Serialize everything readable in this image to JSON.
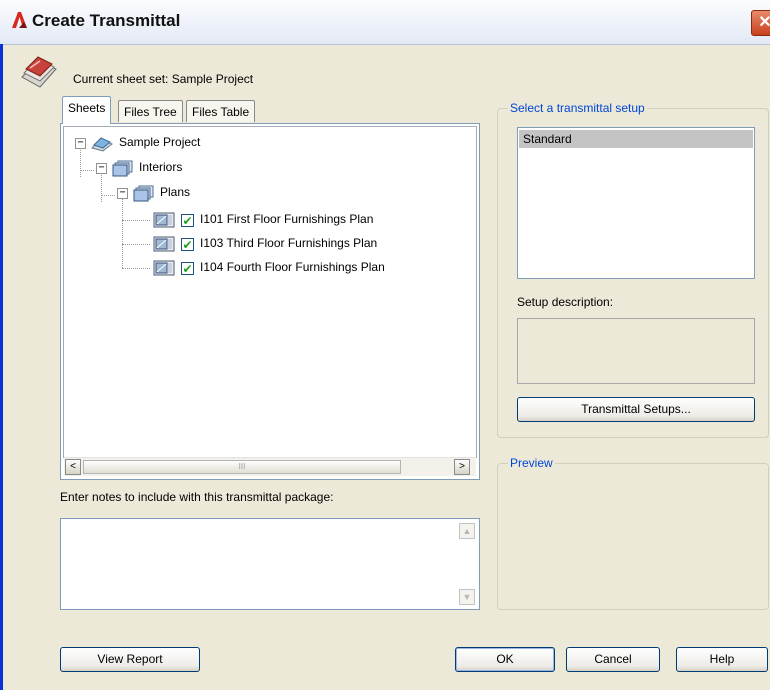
{
  "window": {
    "title": "Create Transmittal",
    "close_glyph": "✕",
    "app_icon": "autocad-a-icon"
  },
  "header": {
    "current_sheet_set": "Current sheet set: Sample Project",
    "icon": "sheet-set-icon"
  },
  "tabs": [
    {
      "label": "Sheets",
      "active": true
    },
    {
      "label": "Files Tree",
      "active": false
    },
    {
      "label": "Files Table",
      "active": false
    }
  ],
  "tree": {
    "root": {
      "label": "Sample Project",
      "expander": "−"
    },
    "subset1": {
      "label": "Interiors",
      "expander": "−"
    },
    "subset2": {
      "label": "Plans",
      "expander": "−"
    },
    "sheets": [
      {
        "label": "I101 First Floor Furnishings Plan",
        "checked": true
      },
      {
        "label": "I103 Third Floor Furnishings Plan",
        "checked": true
      },
      {
        "label": "I104 Fourth Floor Furnishings Plan",
        "checked": true
      }
    ]
  },
  "scrollbar": {
    "left": "<",
    "right": ">",
    "thumb_grip": "III"
  },
  "notes": {
    "label": "Enter notes to include with this transmittal package:",
    "value": "",
    "up": "▲",
    "down": "▼"
  },
  "setup": {
    "group_title": "Select a transmittal setup",
    "items": [
      "Standard"
    ],
    "selected": "Standard",
    "description_label": "Setup description:",
    "description_value": "",
    "setups_button": "Transmittal Setups..."
  },
  "preview": {
    "group_title": "Preview"
  },
  "buttons": {
    "view_report": "View Report",
    "ok": "OK",
    "cancel": "Cancel",
    "help": "Help"
  },
  "colors": {
    "dialog_bg": "#ece9d8",
    "group_title": "#0046d5",
    "selection": "#c4c4c4",
    "check": "#21a121"
  }
}
